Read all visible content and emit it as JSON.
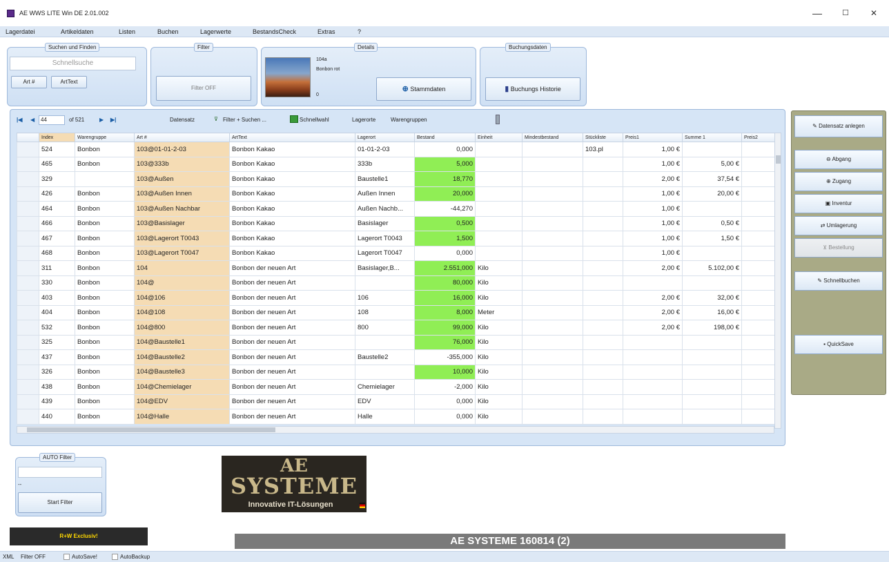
{
  "window": {
    "title": "AE WWS LITE Win DE 2.01.002",
    "minimize": "—",
    "maximize": "☐",
    "close": "✕"
  },
  "menu": [
    "Lagerdatei",
    "Artikeldaten",
    "Listen",
    "Buchen",
    "Lagerwerte",
    "BestandsCheck",
    "Extras",
    "?"
  ],
  "search": {
    "group_label": "Suchen und Finden",
    "placeholder": "Schnellsuche",
    "btn_art": "Art #",
    "btn_arttext": "ArtText"
  },
  "filter": {
    "group_label": "Filter",
    "button": "Filter OFF"
  },
  "details": {
    "group_label": "Details",
    "art_nr": "104a",
    "art_text": "Bonbon rot",
    "value": "0",
    "stamm_button": "Stammdaten"
  },
  "buchungsdaten": {
    "group_label": "Buchungsdaten",
    "button": "Buchungs Historie"
  },
  "nav": {
    "record": "44",
    "of": "of 521",
    "datensatz": "Datensatz",
    "filter_suchen": "Filter + Suchen ...",
    "schnellwahl": "Schnellwahl",
    "lagerorte": "Lagerorte",
    "warengruppen": "Warengruppen"
  },
  "columns": [
    "Index",
    "Warengruppe",
    "Art #",
    "ArtText",
    "Lagerort",
    "Bestand",
    "Einheit",
    "Mindestbestand",
    "Stückliste",
    "Preis1",
    "Summe 1",
    "Preis2"
  ],
  "rows": [
    [
      "524",
      "Bonbon",
      "103@01-01-2-03",
      "Bonbon Kakao",
      "01-01-2-03",
      "0,000",
      "",
      "",
      "103.pl",
      "1,00 €",
      "",
      ""
    ],
    [
      "465",
      "Bonbon",
      "103@333b",
      "Bonbon Kakao",
      "333b",
      "5,000",
      "",
      "",
      "",
      "1,00 €",
      "5,00 €",
      ""
    ],
    [
      "329",
      "",
      "103@Außen",
      "Bonbon Kakao",
      "Baustelle1",
      "18,770",
      "",
      "",
      "",
      "2,00 €",
      "37,54 €",
      ""
    ],
    [
      "426",
      "Bonbon",
      "103@Außen Innen",
      "Bonbon Kakao",
      "Außen Innen",
      "20,000",
      "",
      "",
      "",
      "1,00 €",
      "20,00 €",
      ""
    ],
    [
      "464",
      "Bonbon",
      "103@Außen Nachbar",
      "Bonbon Kakao",
      "Außen Nachb...",
      "-44,270",
      "",
      "",
      "",
      "1,00 €",
      "",
      ""
    ],
    [
      "466",
      "Bonbon",
      "103@Basislager",
      "Bonbon Kakao",
      "Basislager",
      "0,500",
      "",
      "",
      "",
      "1,00 €",
      "0,50 €",
      ""
    ],
    [
      "467",
      "Bonbon",
      "103@Lagerort T0043",
      "Bonbon Kakao",
      "Lagerort T0043",
      "1,500",
      "",
      "",
      "",
      "1,00 €",
      "1,50 €",
      ""
    ],
    [
      "468",
      "Bonbon",
      "103@Lagerort T0047",
      "Bonbon Kakao",
      "Lagerort T0047",
      "0,000",
      "",
      "",
      "",
      "1,00 €",
      "",
      ""
    ],
    [
      "311",
      "Bonbon",
      "104",
      "Bonbon der neuen Art",
      "Basislager,B...",
      "2.551,000",
      "Kilo",
      "",
      "",
      "2,00 €",
      "5.102,00 €",
      ""
    ],
    [
      "330",
      "Bonbon",
      "104@",
      "Bonbon der neuen Art",
      "",
      "80,000",
      "Kilo",
      "",
      "",
      "",
      "",
      ""
    ],
    [
      "403",
      "Bonbon",
      "104@106",
      "Bonbon der neuen Art",
      "106",
      "16,000",
      "Kilo",
      "",
      "",
      "2,00 €",
      "32,00 €",
      ""
    ],
    [
      "404",
      "Bonbon",
      "104@108",
      "Bonbon der neuen Art",
      "108",
      "8,000",
      "Meter",
      "",
      "",
      "2,00 €",
      "16,00 €",
      ""
    ],
    [
      "532",
      "Bonbon",
      "104@800",
      "Bonbon der neuen Art",
      "800",
      "99,000",
      "Kilo",
      "",
      "",
      "2,00 €",
      "198,00 €",
      ""
    ],
    [
      "325",
      "Bonbon",
      "104@Baustelle1",
      "Bonbon der neuen Art",
      "",
      "76,000",
      "Kilo",
      "",
      "",
      "",
      "",
      ""
    ],
    [
      "437",
      "Bonbon",
      "104@Baustelle2",
      "Bonbon der neuen Art",
      "Baustelle2",
      "-355,000",
      "Kilo",
      "",
      "",
      "",
      "",
      ""
    ],
    [
      "326",
      "Bonbon",
      "104@Baustelle3",
      "Bonbon der neuen Art",
      "",
      "10,000",
      "Kilo",
      "",
      "",
      "",
      "",
      ""
    ],
    [
      "438",
      "Bonbon",
      "104@Chemielager",
      "Bonbon der neuen Art",
      "Chemielager",
      "-2,000",
      "Kilo",
      "",
      "",
      "",
      "",
      ""
    ],
    [
      "439",
      "Bonbon",
      "104@EDV",
      "Bonbon der neuen Art",
      "EDV",
      "0,000",
      "Kilo",
      "",
      "",
      "",
      "",
      ""
    ],
    [
      "440",
      "Bonbon",
      "104@Halle",
      "Bonbon der neuen Art",
      "Halle",
      "0,000",
      "Kilo",
      "",
      "",
      "",
      "",
      ""
    ]
  ],
  "green_rows": [
    1,
    2,
    3,
    5,
    6,
    8,
    9,
    10,
    11,
    12,
    13,
    15
  ],
  "right_buttons": [
    "Datensatz anlegen",
    "Abgang",
    "Zugang",
    "Inventur",
    "Umlagerung",
    "Bestellung",
    "Schnellbuchen",
    "QuickSave"
  ],
  "auto_filter": {
    "group_label": "AUTO Filter",
    "dash": "--",
    "button": "Start Filter"
  },
  "logo": {
    "line1": "AE",
    "line2": "SYSTEME",
    "tagline": "Innovative IT-Lösungen"
  },
  "exclusive_badge": "R+W Exclusiv!",
  "banner": "AE SYSTEME 160814 (2)",
  "status": {
    "xml": "XML",
    "filter": "Filter OFF",
    "autosave": "AutoSave!",
    "autobackup": "AutoBackup"
  }
}
